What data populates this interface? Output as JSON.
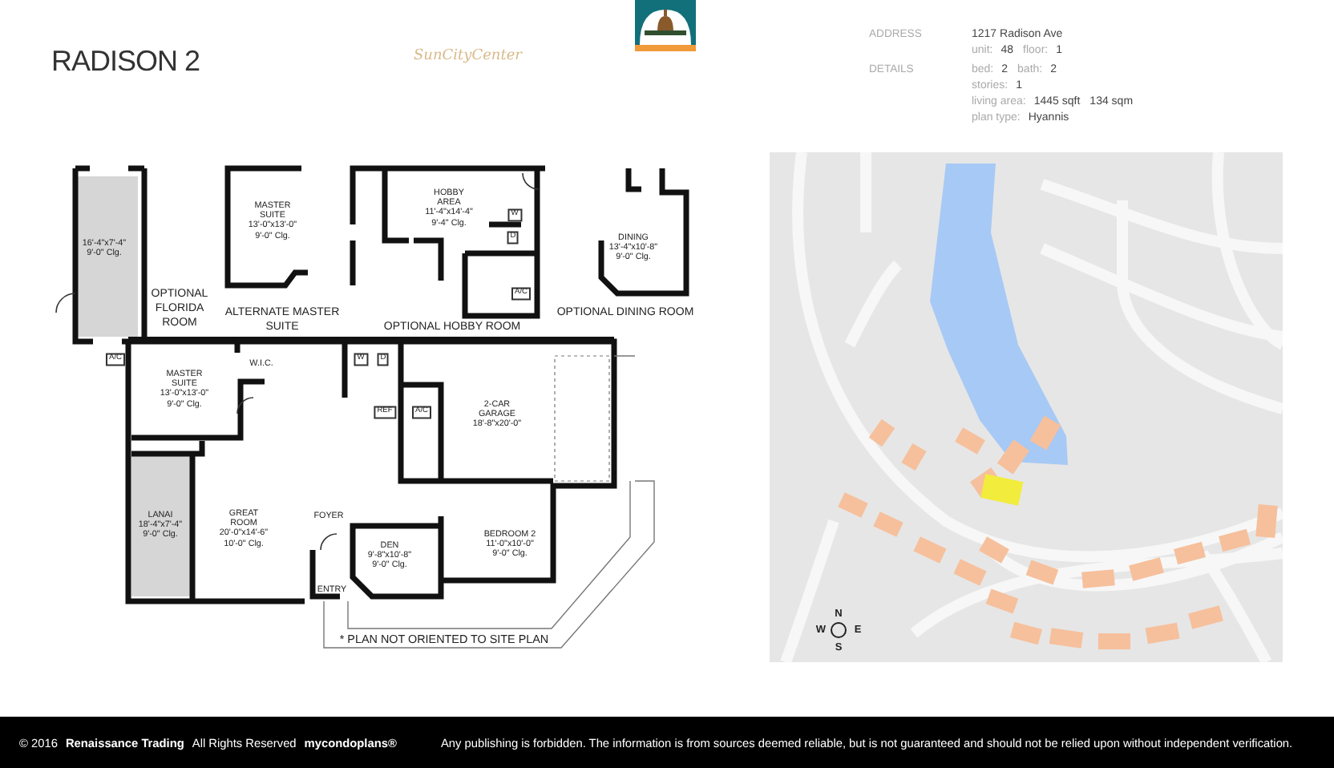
{
  "header": {
    "title": "RADISON 2",
    "brand": "SunCityCenter"
  },
  "property": [
    {
      "label": "ADDRESS",
      "lines": [
        [
          {
            "value": "1217 Radison Ave"
          }
        ],
        [
          {
            "label": "unit:",
            "value": "48"
          },
          {
            "label": "floor:",
            "value": "1"
          }
        ]
      ]
    },
    {
      "label": "DETAILS",
      "lines": [
        [
          {
            "label": "bed:",
            "value": "2"
          },
          {
            "label": "bath:",
            "value": "2"
          }
        ],
        [
          {
            "label": "stories:",
            "value": "1"
          }
        ],
        [
          {
            "label": "living area:",
            "value": "1445 sqft"
          },
          {
            "value": "134 sqm"
          }
        ],
        [
          {
            "label": "plan type:",
            "value": "Hyannis"
          }
        ]
      ]
    }
  ],
  "floor_plan": {
    "labels": [
      {
        "kind": "room",
        "lines": [
          "16'-4\"x7'-4\"",
          "9'-0\" Clg."
        ]
      },
      {
        "kind": "caption",
        "lines": [
          "OPTIONAL",
          "FLORIDA",
          "ROOM"
        ]
      },
      {
        "kind": "room",
        "lines": [
          "MASTER",
          "SUITE",
          "13'-0\"x13'-0\"",
          "9'-0\" Clg."
        ]
      },
      {
        "kind": "caption",
        "lines": [
          "ALTERNATE MASTER",
          "SUITE"
        ]
      },
      {
        "kind": "room",
        "lines": [
          "HOBBY",
          "AREA",
          "11'-4\"x14'-4\"",
          "9'-4\" Clg."
        ]
      },
      {
        "kind": "fixture",
        "lines": [
          "W"
        ]
      },
      {
        "kind": "fixture",
        "lines": [
          "D"
        ]
      },
      {
        "kind": "fixture",
        "lines": [
          "A/C"
        ]
      },
      {
        "kind": "caption",
        "lines": [
          "OPTIONAL HOBBY ROOM"
        ]
      },
      {
        "kind": "room",
        "lines": [
          "DINING",
          "13'-4\"x10'-8\"",
          "9'-0\" Clg."
        ]
      },
      {
        "kind": "caption",
        "lines": [
          "OPTIONAL DINING ROOM"
        ]
      },
      {
        "kind": "fixture",
        "lines": [
          "A/C"
        ]
      },
      {
        "kind": "room",
        "lines": [
          "MASTER",
          "SUITE",
          "13'-0\"x13'-0\"",
          "9'-0\" Clg."
        ]
      },
      {
        "kind": "room",
        "lines": [
          "W.I.C."
        ]
      },
      {
        "kind": "fixture",
        "lines": [
          "W"
        ]
      },
      {
        "kind": "fixture",
        "lines": [
          "D"
        ]
      },
      {
        "kind": "fixture",
        "lines": [
          "REF"
        ]
      },
      {
        "kind": "fixture",
        "lines": [
          "A/C"
        ]
      },
      {
        "kind": "room",
        "lines": [
          "2-CAR",
          "GARAGE",
          "18'-8\"x20'-0\""
        ]
      },
      {
        "kind": "room",
        "lines": [
          "LANAI",
          "18'-4\"x7'-4\"",
          "9'-0\" Clg."
        ]
      },
      {
        "kind": "room",
        "lines": [
          "GREAT",
          "ROOM",
          "20'-0\"x14'-6\"",
          "10'-0\" Clg."
        ]
      },
      {
        "kind": "room",
        "lines": [
          "FOYER"
        ]
      },
      {
        "kind": "room",
        "lines": [
          "DEN",
          "9'-8\"x10'-8\"",
          "9'-0\" Clg."
        ]
      },
      {
        "kind": "room",
        "lines": [
          "BEDROOM 2",
          "11'-0\"x10'-0\"",
          "9'-0\" Clg."
        ]
      },
      {
        "kind": "room",
        "lines": [
          "ENTRY"
        ]
      },
      {
        "kind": "note",
        "lines": [
          "* PLAN NOT ORIENTED TO SITE PLAN"
        ]
      }
    ]
  },
  "site_map": {
    "compass": [
      "N",
      "W",
      "E",
      "S"
    ]
  },
  "footer": {
    "left": [
      {
        "text": "© 2016",
        "bold": false
      },
      {
        "text": "Renaissance Trading",
        "bold": true
      },
      {
        "text": "All Rights Reserved",
        "bold": false
      },
      {
        "text": "mycondoplans®",
        "bold": true
      }
    ],
    "notice": "Any publishing is forbidden.  The information is from sources deemed reliable, but is not guaranteed and should not be relied upon without independent verification."
  }
}
